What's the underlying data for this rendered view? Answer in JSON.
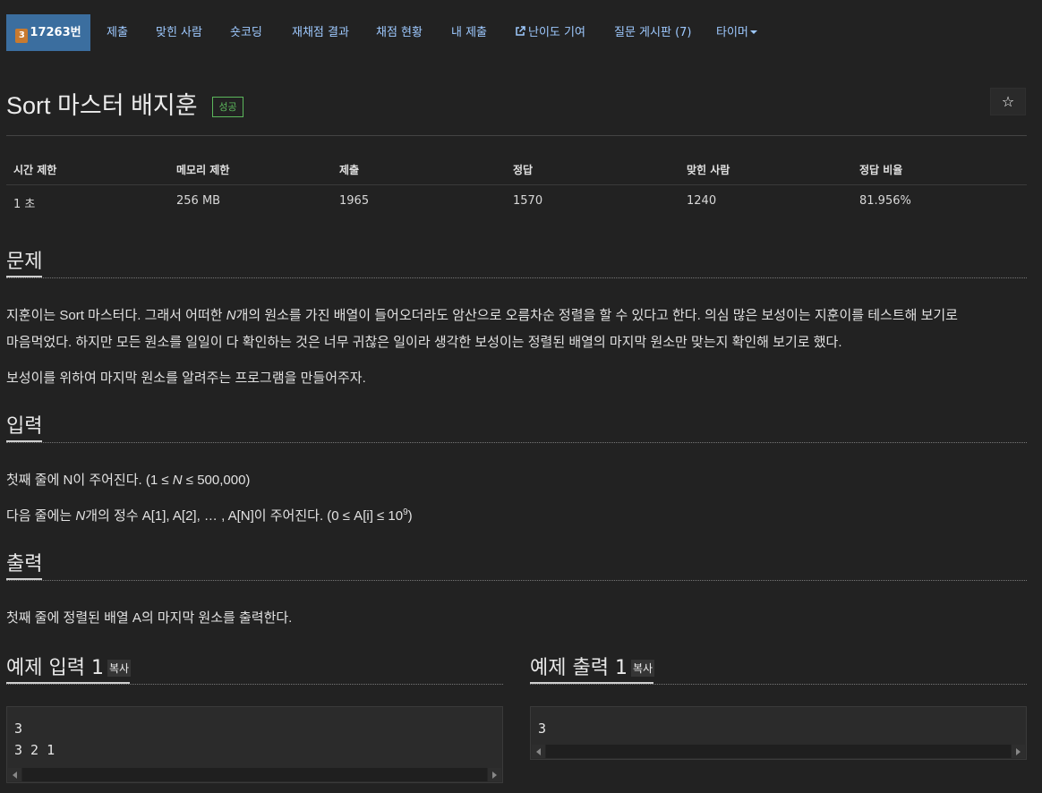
{
  "nav": {
    "problem_badge": "3",
    "problem_number": "17263번",
    "items": [
      "제출",
      "맞힌 사람",
      "숏코딩",
      "재채점 결과",
      "채점 현황",
      "내 제출",
      "난이도 기여",
      "질문 게시판 (7)",
      "타이머"
    ]
  },
  "problem": {
    "title": "Sort 마스터 배지훈",
    "status_label": "성공",
    "star": "☆"
  },
  "info_table": {
    "headers": [
      "시간 제한",
      "메모리 제한",
      "제출",
      "정답",
      "맞힌 사람",
      "정답 비율"
    ],
    "values": [
      "1 초",
      "256 MB",
      "1965",
      "1570",
      "1240",
      "81.956%"
    ]
  },
  "sections": {
    "description_heading": "문제",
    "description_line1_a": "지훈이는 Sort 마스터다. 그래서 어떠한 ",
    "description_line1_n": "N",
    "description_line1_b": "개의 원소를 가진 배열이 들어오더라도 암산으로 오름차순 정렬을 할 수 있다고 한다. 의심 많은 보성이는 지훈이를 테스트해 보기로",
    "description_line2": "마음먹었다. 하지만 모든 원소를 일일이 다 확인하는 것은 너무 귀찮은 일이라 생각한 보성이는 정렬된 배열의 마지막 원소만 맞는지 확인해 보기로 했다.",
    "description_line3": "보성이를 위하여 마지막 원소를 알려주는 프로그램을 만들어주자.",
    "input_heading": "입력",
    "input_line1_a": "첫째 줄에 N이 주어진다. (1 ≤ ",
    "input_line1_n": "N",
    "input_line1_b": " ≤ 500,000)",
    "input_line2_n": "N",
    "input_line2_a": "개의 정수 A[1], A[2], … , A[N]이 주어진다. (0 ≤ A[i] ≤ 10",
    "input_line2_prefix": "다음 줄에는 ",
    "input_line2_sup": "9",
    "input_line2_end": ")",
    "output_heading": "출력",
    "output_line1": "첫째 줄에 정렬된 배열 A의 마지막 원소를 출력한다."
  },
  "samples": {
    "input_heading": "예제 입력 1",
    "output_heading": "예제 출력 1",
    "copy_label": "복사",
    "input_text": "3\n3 2 1",
    "output_text": "3"
  }
}
